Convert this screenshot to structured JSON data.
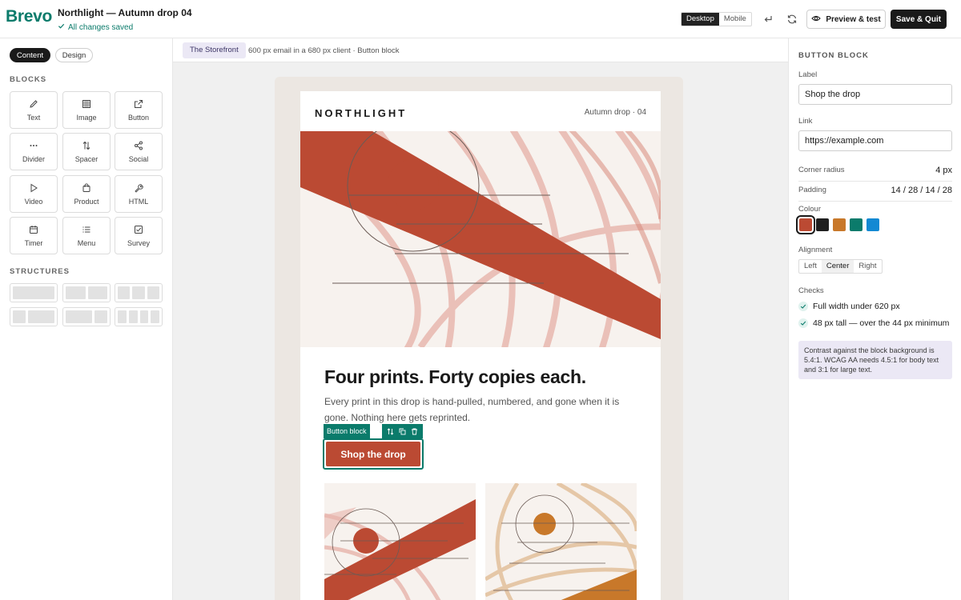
{
  "app": {
    "logo": "Brevo",
    "document_title": "Northlight — Autumn drop 04",
    "save_status": "All changes saved"
  },
  "toolbar": {
    "device_options": [
      "Desktop",
      "Mobile"
    ],
    "device_selected": "Desktop",
    "preview_label": "Preview & test",
    "save_label": "Save & Quit"
  },
  "left_panel": {
    "tabs": [
      "Content",
      "Design"
    ],
    "active_tab": "Content",
    "blocks_heading": "BLOCKS",
    "blocks": [
      {
        "label": "Text",
        "icon": "pencil-icon"
      },
      {
        "label": "Image",
        "icon": "image-grid-icon"
      },
      {
        "label": "Button",
        "icon": "external-link-icon"
      },
      {
        "label": "Divider",
        "icon": "dots-icon"
      },
      {
        "label": "Spacer",
        "icon": "vertical-arrows-icon"
      },
      {
        "label": "Social",
        "icon": "share-icon"
      },
      {
        "label": "Video",
        "icon": "play-icon"
      },
      {
        "label": "Product",
        "icon": "shopping-bag-icon"
      },
      {
        "label": "HTML",
        "icon": "wrench-icon"
      },
      {
        "label": "Timer",
        "icon": "calendar-icon"
      },
      {
        "label": "Menu",
        "icon": "list-icon"
      },
      {
        "label": "Survey",
        "icon": "checkbox-icon"
      }
    ],
    "structures_heading": "STRUCTURES"
  },
  "canvas": {
    "store_chip": "The Storefront",
    "meta": "600 px email in a 680 px client · Button block",
    "email": {
      "brand": "NORTHLIGHT",
      "issue": "Autumn drop · 04",
      "headline": "Four prints. Forty copies each.",
      "body": "Every print in this drop is hand-pulled, numbered, and gone when it is gone. Nothing here gets reprinted.",
      "selected_block_tag": "Button block",
      "cta_label": "Shop the drop"
    }
  },
  "right_panel": {
    "title": "BUTTON BLOCK",
    "label_field_label": "Label",
    "label_value": "Shop the drop",
    "link_field_label": "Link",
    "link_value": "https://example.com",
    "corner_radius_label": "Corner radius",
    "corner_radius_value": "4 px",
    "padding_label": "Padding",
    "padding_value": "14 / 28 / 14 / 28",
    "colour_label": "Colour",
    "colours": [
      "#bb4a33",
      "#1f1f1f",
      "#c8782a",
      "#0b7b6b",
      "#1389d3"
    ],
    "colour_selected": "#bb4a33",
    "alignment_label": "Alignment",
    "alignment_options": [
      "Left",
      "Center",
      "Right"
    ],
    "alignment_selected": "Center",
    "checks_label": "Checks",
    "checks": [
      "Full width under 620 px",
      "48 px tall — over the 44 px minimum"
    ],
    "notice": "Contrast against the block background is 5.4:1. WCAG AA needs 4.5:1 for body text and 3:1 for large text."
  },
  "colors": {
    "brand_green": "#0b7b6b",
    "button_red": "#bb4a33",
    "notice_bg": "#ebe8f5"
  }
}
